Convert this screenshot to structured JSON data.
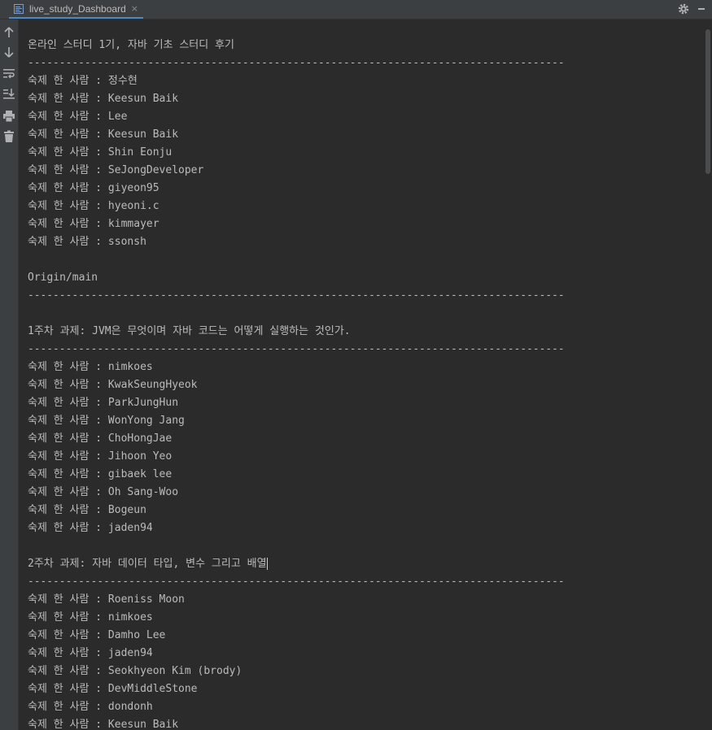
{
  "tab": {
    "title": "live_study_Dashboard",
    "close_glyph": "×",
    "icon": "console-icon"
  },
  "header_icons": [
    "gear-icon",
    "minimize-icon"
  ],
  "toolbar": [
    "up-arrow-icon",
    "down-arrow-icon",
    "soft-wrap-icon",
    "scroll-to-end-icon",
    "print-icon",
    "trash-icon"
  ],
  "console": {
    "lines": [
      "온라인 스터디 1기, 자바 기초 스터디 후기",
      "-------------------------------------------------------------------------------------",
      "숙제 한 사람 : 정수현",
      "숙제 한 사람 : Keesun Baik",
      "숙제 한 사람 : Lee",
      "숙제 한 사람 : Keesun Baik",
      "숙제 한 사람 : Shin Eonju",
      "숙제 한 사람 : SeJongDeveloper",
      "숙제 한 사람 : giyeon95",
      "숙제 한 사람 : hyeoni.c",
      "숙제 한 사람 : kimmayer",
      "숙제 한 사람 : ssonsh",
      "",
      "Origin/main",
      "-------------------------------------------------------------------------------------",
      "",
      "1주차 과제: JVM은 무엇이며 자바 코드는 어떻게 실행하는 것인가.",
      "-------------------------------------------------------------------------------------",
      "숙제 한 사람 : nimkoes",
      "숙제 한 사람 : KwakSeungHyeok",
      "숙제 한 사람 : ParkJungHun",
      "숙제 한 사람 : WonYong Jang",
      "숙제 한 사람 : ChoHongJae",
      "숙제 한 사람 : Jihoon Yeo",
      "숙제 한 사람 : gibaek lee",
      "숙제 한 사람 : Oh Sang-Woo",
      "숙제 한 사람 : Bogeun",
      "숙제 한 사람 : jaden94",
      "",
      "2주차 과제: 자바 데이터 타입, 변수 그리고 배열",
      "-------------------------------------------------------------------------------------",
      "숙제 한 사람 : Roeniss Moon",
      "숙제 한 사람 : nimkoes",
      "숙제 한 사람 : Damho Lee",
      "숙제 한 사람 : jaden94",
      "숙제 한 사람 : Seokhyeon Kim (brody)",
      "숙제 한 사람 : DevMiddleStone",
      "숙제 한 사람 : dondonh",
      "숙제 한 사람 : Keesun Baik"
    ]
  }
}
